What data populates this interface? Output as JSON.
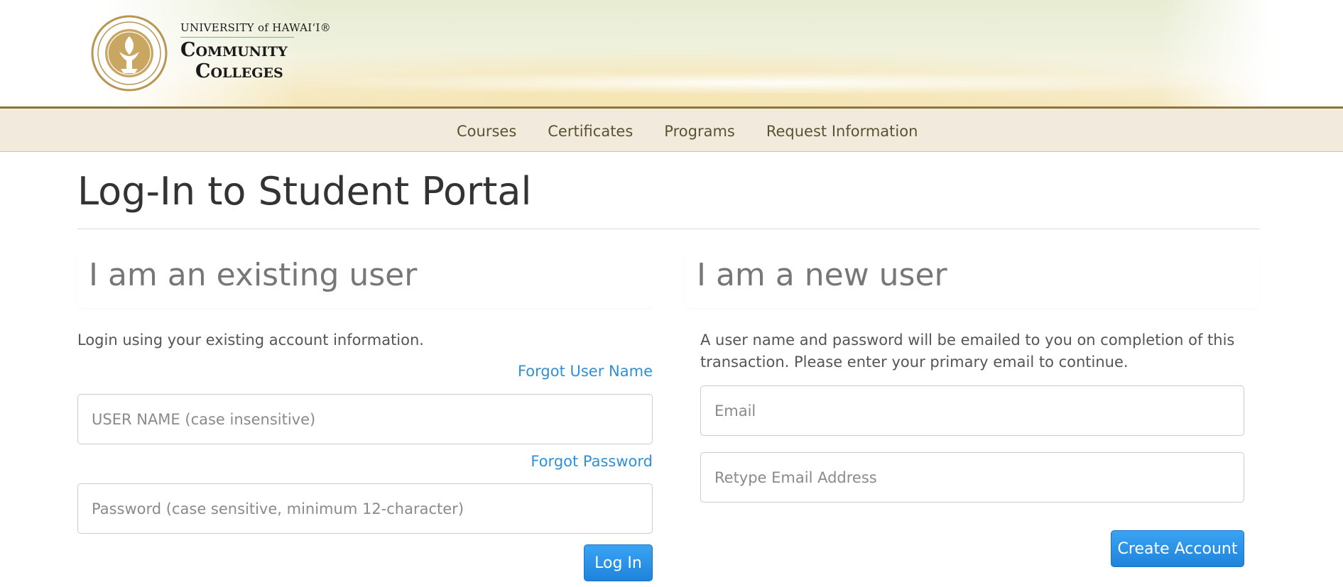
{
  "header": {
    "university_text": "UNIVERSITY of HAWAIʻI®",
    "brand_line1": "Community",
    "brand_line2": "Colleges",
    "seal_icon": "university-seal-icon",
    "colors": {
      "nav_border": "#8d7443",
      "nav_bg": "#f2ebdd",
      "link": "#2f8fd8",
      "button": "#1f83db"
    }
  },
  "nav": {
    "items": [
      {
        "label": "Courses"
      },
      {
        "label": "Certificates"
      },
      {
        "label": "Programs"
      },
      {
        "label": "Request Information"
      }
    ]
  },
  "page": {
    "title": "Log-In to Student Portal"
  },
  "existing_user": {
    "heading": "I am an existing user",
    "description": "Login using your existing account information.",
    "forgot_username": "Forgot User Name",
    "username_placeholder": "USER NAME (case insensitive)",
    "username_value": "",
    "forgot_password": "Forgot Password",
    "password_placeholder": "Password (case sensitive, minimum 12-character)",
    "password_value": "",
    "login_button": "Log In"
  },
  "new_user": {
    "heading": "I am a new user",
    "description": "A user name and password will be emailed to you on completion of this transaction. Please enter your primary email to continue.",
    "email_placeholder": "Email",
    "email_value": "",
    "retype_placeholder": "Retype Email Address",
    "retype_value": "",
    "create_button": "Create Account"
  }
}
